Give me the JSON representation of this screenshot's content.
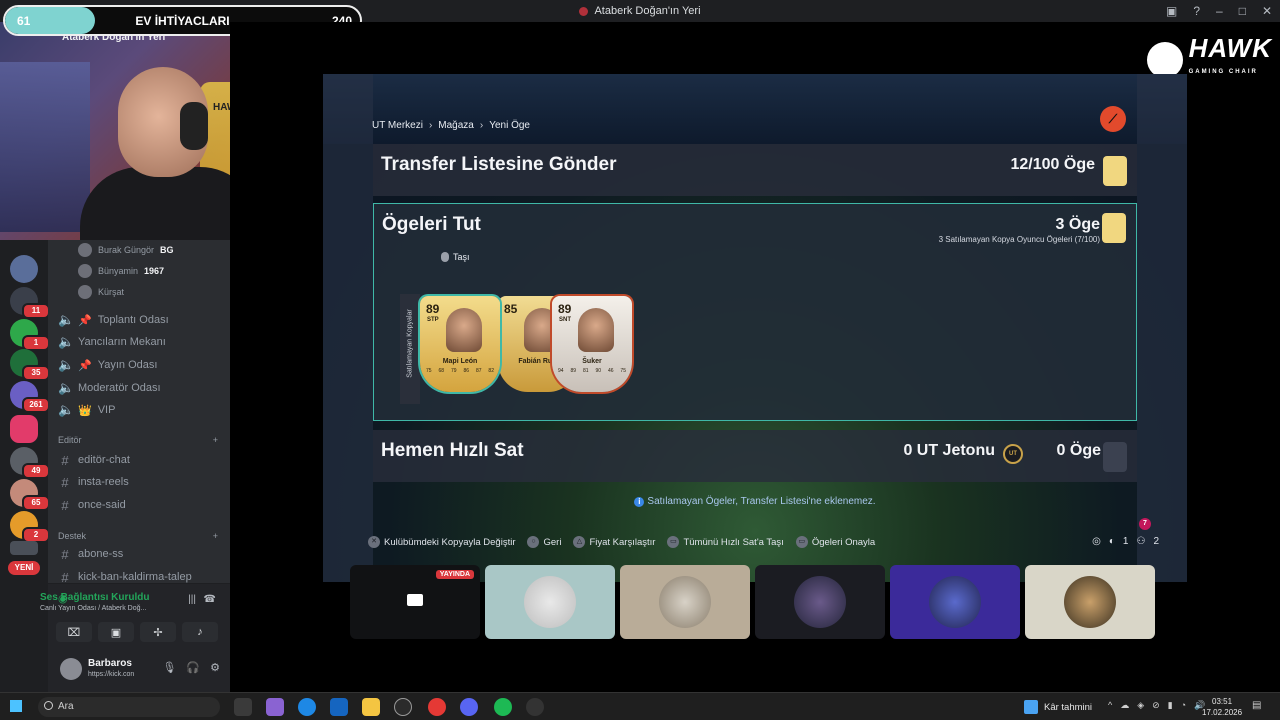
{
  "window": {
    "title": "Ataberk Doğan'ın Yeri"
  },
  "goal": {
    "current": "61",
    "title": "EV İHTİYACLARI",
    "target": "240",
    "progress_fraction": 0.2542
  },
  "webcam": {
    "server_name": "Ataberk Doğan'ın Yeri",
    "chair_brand": "HAWK"
  },
  "rail_badges": [
    "11",
    "1",
    "35",
    "261",
    "49",
    "65",
    "2"
  ],
  "rail_new": "YENİ",
  "voice_users": [
    {
      "name": "Burak Güngör",
      "tag": "BG"
    },
    {
      "name": "Bünyamin",
      "tag": "1967"
    },
    {
      "name": "Kürşat",
      "tag": ""
    }
  ],
  "voice_channels": [
    {
      "label": "Toplantı Odası",
      "prefix": "📌"
    },
    {
      "label": "Yancıların Mekanı",
      "prefix": ""
    },
    {
      "label": "Yayın Odası",
      "prefix": "📌"
    },
    {
      "label": "Moderatör Odası",
      "prefix": ""
    },
    {
      "label": "VIP",
      "prefix": "👑"
    }
  ],
  "categories": {
    "editor": "Editör",
    "destek": "Destek"
  },
  "text_channels_editor": [
    "editör-chat",
    "insta-reels",
    "once-said"
  ],
  "text_channels_destek": [
    "abone-ss",
    "kick-ban-kaldirma-talep"
  ],
  "voice_panel": {
    "title": "Ses Bağlantısı Kuruldu",
    "subtitle": "Canlı Yayın Odası / Ataberk Doğ..."
  },
  "user_panel": {
    "name": "Barbaros",
    "sub": "https://kick.con"
  },
  "game": {
    "breadcrumb": [
      "UT Merkezi",
      "Mağaza",
      "Yeni Öge"
    ],
    "transfer": {
      "title": "Transfer Listesine Gönder",
      "count": "12/100 Öge"
    },
    "keep": {
      "title": "Ögeleri Tut",
      "count": "3 Öge",
      "sub": "3 Satılamayan Kopya Oyuncu Ögeleri (7/100)",
      "move_label": "Taşı",
      "stack_label": "Satılamayan Kopyalar"
    },
    "cards": [
      {
        "rating": "89",
        "pos": "STP",
        "name": "Mapi León",
        "stats": [
          "75",
          "68",
          "79",
          "86",
          "87",
          "82"
        ]
      },
      {
        "rating": "85",
        "pos": "",
        "name": "Fabián Ruiz",
        "stats": [
          "",
          "",
          "",
          "",
          "",
          ""
        ]
      },
      {
        "rating": "89",
        "pos": "SNT",
        "name": "Šuker",
        "stats": [
          "94",
          "89",
          "81",
          "90",
          "46",
          "75"
        ]
      }
    ],
    "quicksell": {
      "title": "Hemen Hızlı Sat",
      "coins": "0 UT Jetonu",
      "coin_icon": "UT",
      "count": "0 Öge"
    },
    "info": "Satılamayan Ögeler, Transfer Listesi'ne eklenemez.",
    "hints": [
      {
        "btn": "✕",
        "label": "Kulübümdeki Kopyayla Değiştir"
      },
      {
        "btn": "○",
        "label": "Geri"
      },
      {
        "btn": "△",
        "label": "Fiyat Karşılaştır"
      },
      {
        "btn": "▭",
        "label": "Tümünü Hızlı Sat'a Taşı"
      },
      {
        "btn": "▭",
        "label": "Ögeleri Onayla"
      }
    ],
    "status": {
      "notif": "7",
      "mic": "1",
      "people": "2"
    }
  },
  "brand": {
    "name": "HAWK",
    "tagline": "GAMING CHAIR"
  },
  "tiles": {
    "live_label": "YAYINDA"
  },
  "taskbar": {
    "search": "Ara",
    "weather": "Kâr tahmini",
    "time": "03:51",
    "date": "17.02.2026"
  }
}
